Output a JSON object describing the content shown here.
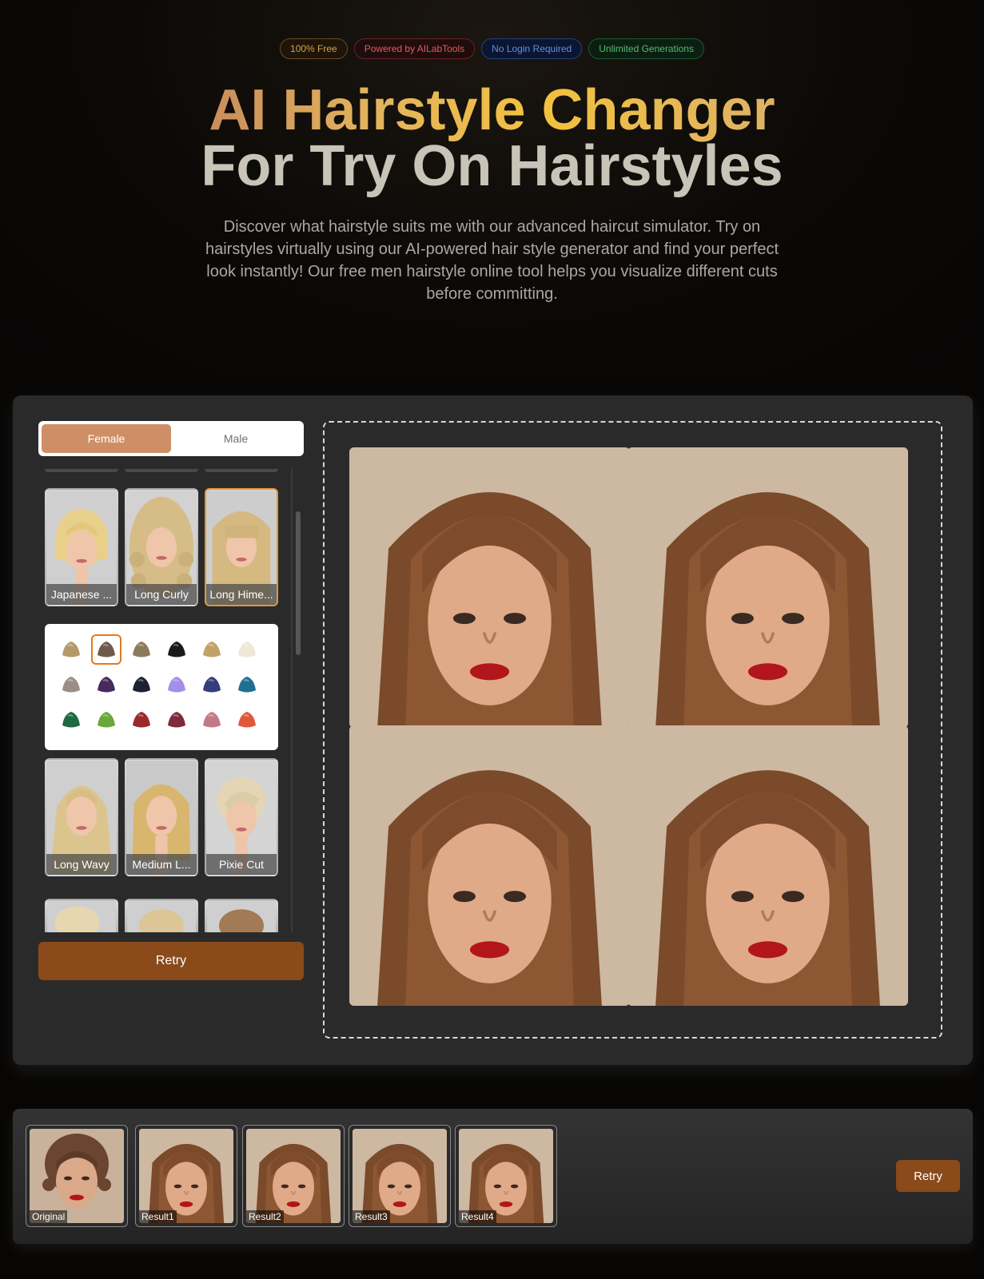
{
  "badges": [
    {
      "label": "100% Free"
    },
    {
      "label": "Powered by AILabTools"
    },
    {
      "label": "No Login Required"
    },
    {
      "label": "Unlimited Generations"
    }
  ],
  "hero": {
    "title_line1": "AI Hairstyle Changer",
    "title_line2": "For Try On Hairstyles",
    "description": "Discover what hairstyle suits me with our advanced haircut simulator. Try on hairstyles virtually using our AI-powered hair style generator and find your perfect look instantly! Our free men hairstyle online tool helps you visualize different cuts before committing."
  },
  "gender": {
    "female": "Female",
    "male": "Male",
    "selected": "Female"
  },
  "styles_row1": [
    {
      "label": "Japanese ...",
      "hair": "#e6cf8c"
    },
    {
      "label": "Long Curly",
      "hair": "#d9c08a"
    },
    {
      "label": "Long Hime...",
      "hair": "#d8bd86"
    }
  ],
  "styles_row2": [
    {
      "label": "Long Wavy",
      "hair": "#dcc48e"
    },
    {
      "label": "Medium L...",
      "hair": "#d8b66e"
    },
    {
      "label": "Pixie Cut",
      "hair": "#e4d6b4"
    }
  ],
  "selected_style": "Long Hime...",
  "hair_colors": [
    "#b49a6a",
    "#6e5a4c",
    "#8c7a5e",
    "#1a1a1a",
    "#c2a266",
    "#efe8d6",
    "#9a8e86",
    "#4a2a5e",
    "#1c2230",
    "#a48ee8",
    "#343e7a",
    "#1f7090",
    "#1e6a40",
    "#6aa83a",
    "#9a2a2c",
    "#7e2a3c",
    "#c47a86",
    "#e0583a"
  ],
  "selected_color_index": 1,
  "retry_label": "Retry",
  "history": {
    "items": [
      {
        "label": "Original"
      },
      {
        "label": "Result1"
      },
      {
        "label": "Result2"
      },
      {
        "label": "Result3"
      },
      {
        "label": "Result4"
      }
    ],
    "retry_label": "Retry"
  }
}
